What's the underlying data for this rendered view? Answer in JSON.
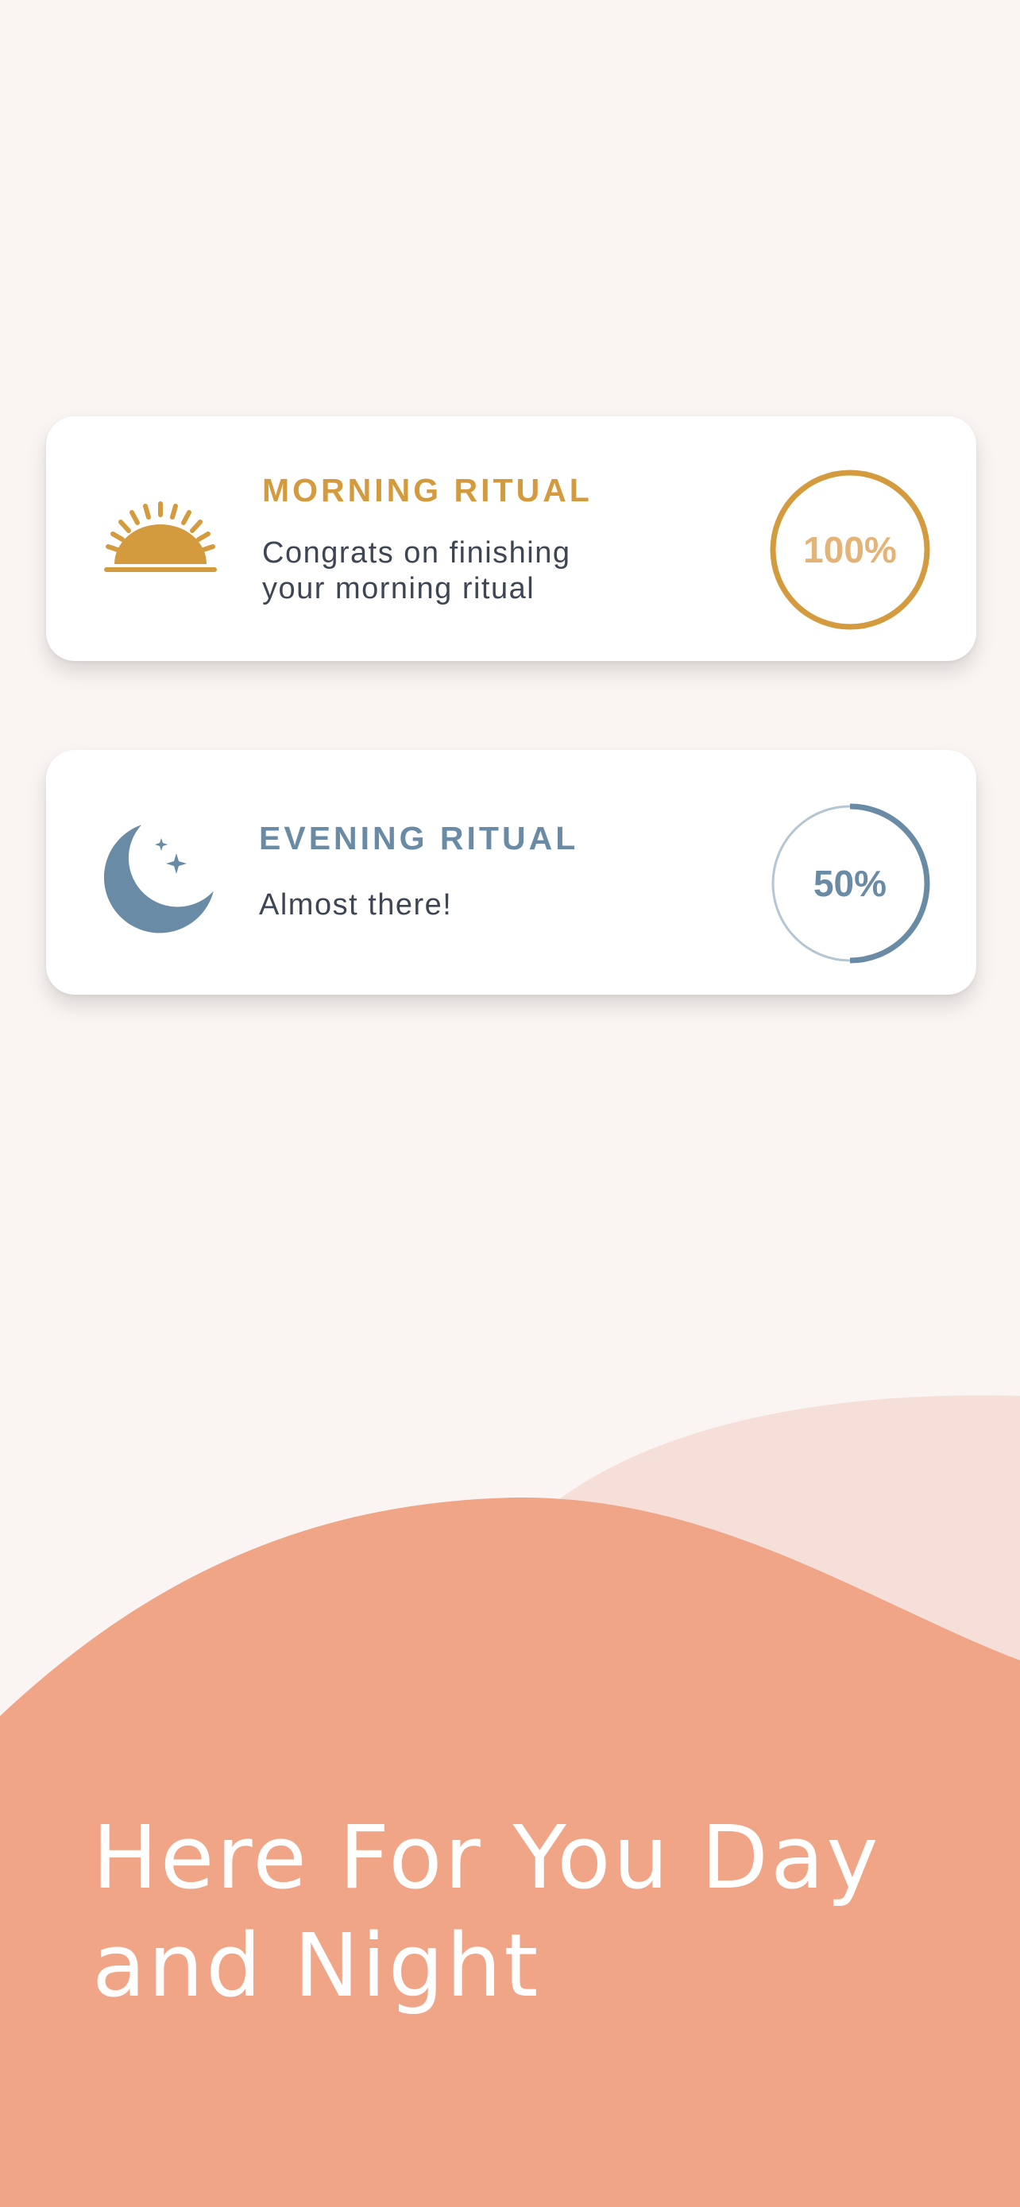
{
  "theme": {
    "background": "#FAF5F3",
    "card_background": "#FFFFFF",
    "morning_accent": "#D39A3E",
    "morning_percent_text": "#E3B377",
    "evening_accent": "#6A8BA6",
    "evening_track": "#B5C6D3",
    "description_text": "#3E4654",
    "wave_light": "#F6DFD8",
    "wave_main": "#F0A587",
    "headline_text": "#FFFFFF"
  },
  "rituals": {
    "morning": {
      "icon": "sunrise-icon",
      "title": "MORNING RITUAL",
      "description": "Congrats on finishing\nyour morning ritual",
      "progress": 1.0,
      "progress_label": "100%"
    },
    "evening": {
      "icon": "crescent-moon-stars-icon",
      "title": "EVENING RITUAL",
      "description": "Almost there!",
      "progress": 0.5,
      "progress_label": "50%"
    }
  },
  "hero": {
    "headline": "Here For You Day\nand Night"
  }
}
